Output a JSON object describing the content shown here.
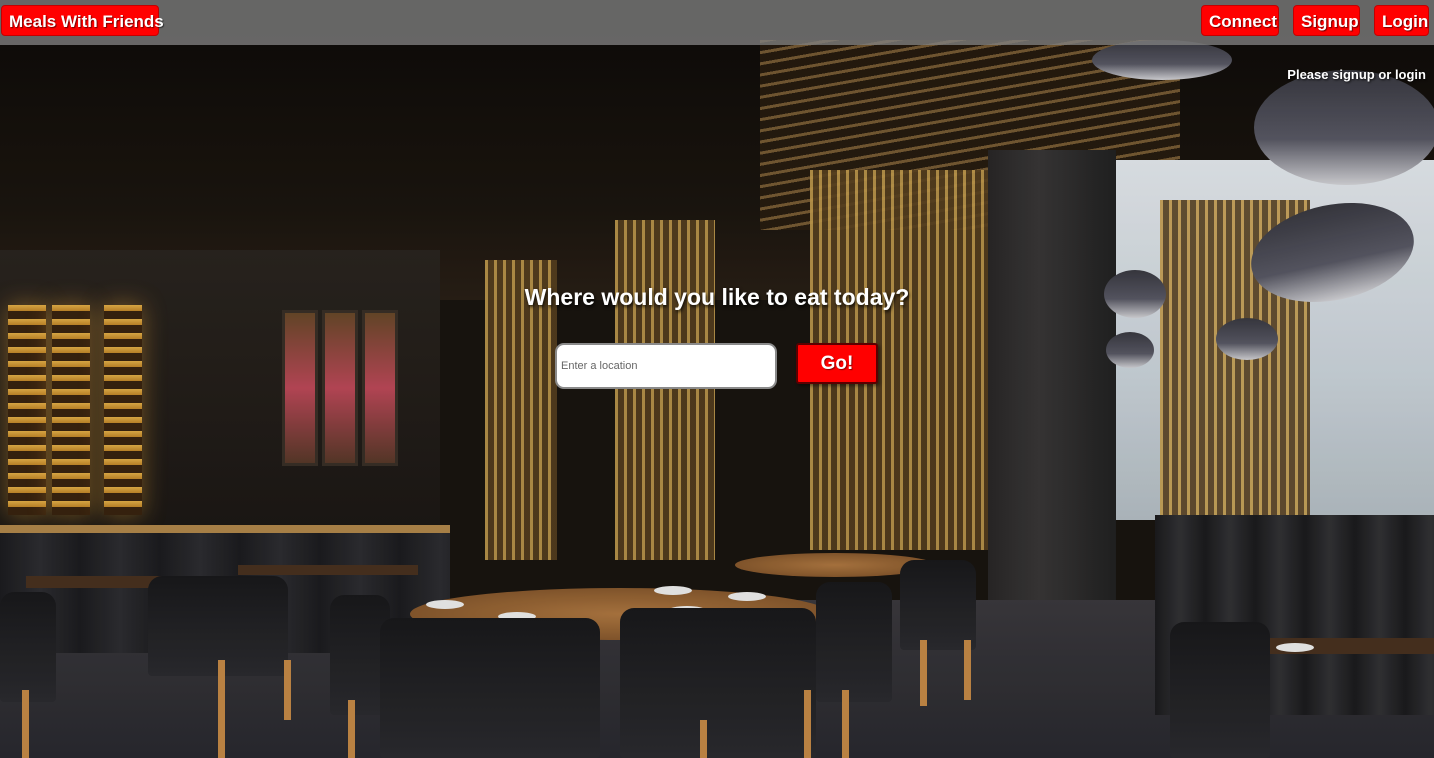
{
  "navbar": {
    "brand_label": "Meals With Friends",
    "connect_label": "Connect",
    "signup_label": "Signup",
    "login_label": "Login"
  },
  "status": {
    "message": "Please signup or login"
  },
  "hero": {
    "heading": "Where would you like to eat today?",
    "search_placeholder": "Enter a location",
    "search_value": "",
    "go_label": "Go!"
  },
  "background": {
    "icon": "restaurant-interior-photo"
  },
  "colors": {
    "accent": "#ff0000",
    "navbar_background": "#808080",
    "text_on_accent": "#ffffff"
  }
}
